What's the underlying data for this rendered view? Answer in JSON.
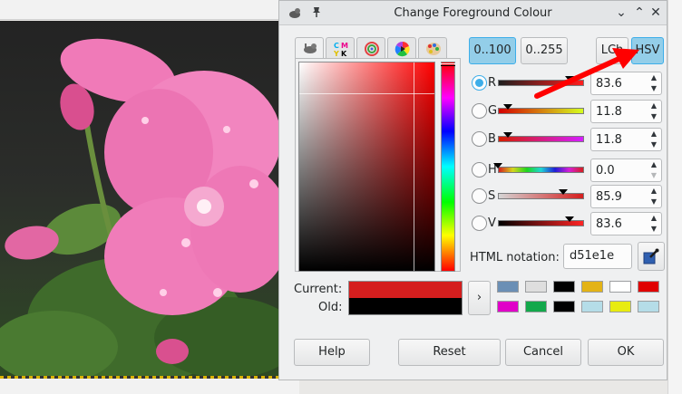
{
  "dialog": {
    "title": "Change Foreground Colour"
  },
  "range_buttons": {
    "range_100": "0..100",
    "range_255": "0..255"
  },
  "model_buttons": {
    "lch": "LCh",
    "hsv": "HSV"
  },
  "channels": [
    {
      "label": "R",
      "value": "83.6",
      "selected": true
    },
    {
      "label": "G",
      "value": "11.8",
      "selected": false
    },
    {
      "label": "B",
      "value": "11.8",
      "selected": false
    },
    {
      "label": "H",
      "value": "0.0",
      "selected": false
    },
    {
      "label": "S",
      "value": "85.9",
      "selected": false
    },
    {
      "label": "V",
      "value": "83.6",
      "selected": false
    }
  ],
  "html_notation": {
    "label": "HTML notation:",
    "value": "d51e1e"
  },
  "swatches": {
    "current_label": "Current:",
    "old_label": "Old:",
    "current_color": "#d51e1e",
    "old_color": "#000000"
  },
  "history_colors": [
    "#6b8fb5",
    "#dedede",
    "#000000",
    "#e3b317",
    "#ffffff",
    "#e00000",
    "#e000c8",
    "#13a84b",
    "#000000",
    "#b5dde8",
    "#e8ec10",
    "#b5dde8"
  ],
  "buttons": {
    "help": "Help",
    "reset": "Reset",
    "cancel": "Cancel",
    "ok": "OK"
  },
  "colors": {
    "accent": "#3daee9",
    "annotation_arrow": "#ff0000"
  }
}
